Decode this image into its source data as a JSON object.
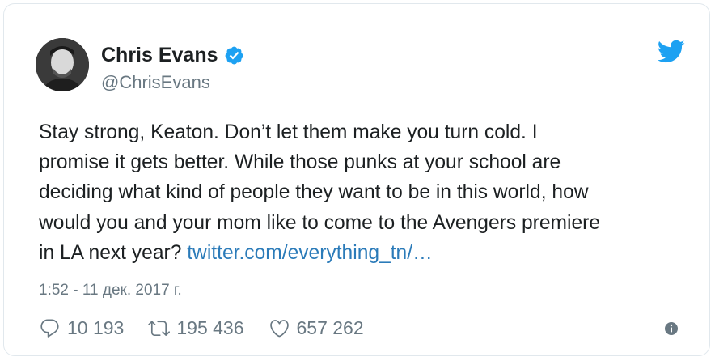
{
  "author": {
    "display_name": "Chris Evans",
    "handle": "@ChrisEvans",
    "verified": true,
    "verified_icon": "verified-badge-icon",
    "avatar": "avatar-photo"
  },
  "brand": {
    "icon": "twitter-bird-icon",
    "color": "#1da1f2"
  },
  "tweet": {
    "lines": [
      "Stay strong, Keaton. Don’t let them make you turn cold. I",
      "promise it gets better. While those punks at your school are",
      "deciding what kind of people they want to be in this world, how",
      "would you and your mom like to come to the Avengers premiere"
    ],
    "last_line_text": "in LA next year? ",
    "link_text": "twitter.com/everything_tn/…",
    "link_color": "#2b7bb9"
  },
  "timestamp": "1:52 - 11 дек. 2017 г.",
  "actions": {
    "replies": {
      "icon": "reply-icon",
      "count": "10 193"
    },
    "retweets": {
      "icon": "retweet-icon",
      "count": "195 436"
    },
    "likes": {
      "icon": "heart-icon",
      "count": "657 262"
    },
    "info_icon": "info-icon"
  },
  "colors": {
    "text": "#1c2022",
    "secondary": "#697882",
    "border": "#e1e8ed"
  }
}
